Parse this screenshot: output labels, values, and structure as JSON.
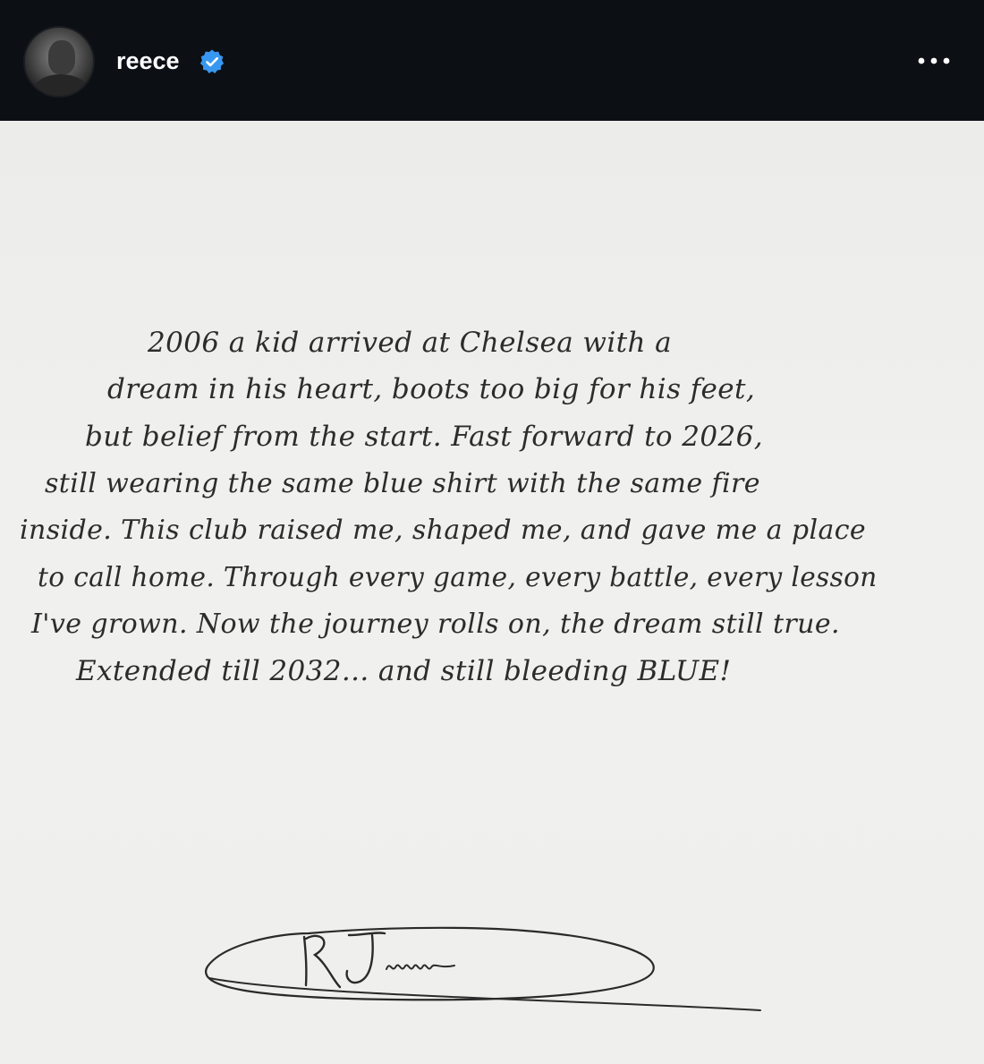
{
  "post": {
    "username": "reece",
    "verified_icon": "verified-badge-icon",
    "more_icon": "more-options-icon",
    "accent_color": "#3897f0",
    "header_bg": "#0c0f14"
  },
  "letter": {
    "lines": [
      "2006 a kid arrived at Chelsea with a",
      "dream in his heart, boots too big for his feet,",
      "but belief from the start. Fast forward to 2026,",
      "still wearing the same blue shirt with the same fire",
      "inside. This club raised me, shaped me, and gave me a place",
      "to call home. Through every game, every battle, every lesson",
      "I've grown. Now the journey rolls on, the dream still true.",
      "Extended till 2032... and still bleeding BLUE!"
    ]
  }
}
